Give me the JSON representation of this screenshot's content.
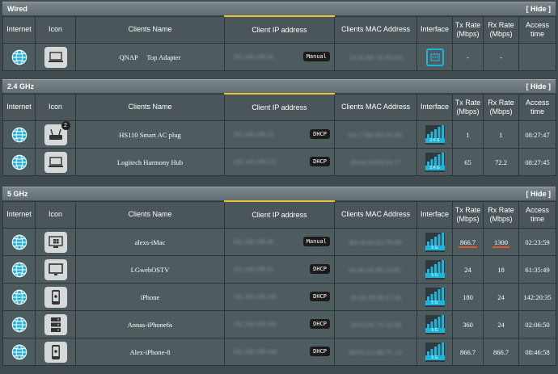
{
  "headers": {
    "internet": "Internet",
    "icon": "Icon",
    "name": "Clients Name",
    "ip": "Client IP address",
    "mac": "Clients MAC Address",
    "iface": "Interface",
    "tx1": "Tx Rate",
    "tx2": "(Mbps)",
    "rx1": "Rx Rate",
    "rx2": "(Mbps)",
    "access": "Access time"
  },
  "hide_label": "[ Hide ]",
  "colors": {
    "accent": "#1fb4d9",
    "highlight": "#e05a1c",
    "ip_header_bar": "#e8c233"
  },
  "sections": [
    {
      "title": "Wired",
      "rows": [
        {
          "icon": "laptop-icon",
          "name": "QNAP     Top Adapter",
          "ip": "192.168.199.56",
          "ip_type": "Manual",
          "mac": "24:5E:BE:1E:9A:E9",
          "iface": "ethernet-icon",
          "tx": "-",
          "rx": "-",
          "access": ""
        }
      ]
    },
    {
      "title": "2.4 GHz",
      "rows": [
        {
          "icon": "router-icon",
          "badge": "2",
          "name": "HS110 Smart AC plug",
          "ip": "192.168.199.23",
          "ip_type": "DHCP",
          "mac": "50:C7:BF:BD:91:BC",
          "iface": "wifi-signal-icon",
          "band": "2.4 G",
          "tx": "1",
          "rx": "1",
          "access": "08:27:47"
        },
        {
          "icon": "laptop-icon",
          "name": "Logitech Harmony Hub",
          "ip": "192.168.199.122",
          "ip_type": "DHCP",
          "mac": "00:04:20:EB:E6:77",
          "iface": "wifi-signal-icon",
          "band": "2.4 G",
          "tx": "65",
          "rx": "72.2",
          "access": "08:27:45"
        }
      ]
    },
    {
      "title": "5 GHz",
      "rows": [
        {
          "icon": "windows-pc-icon",
          "name": "alexs-iMac",
          "ip": "192.168.199.38",
          "ip_type": "Manual",
          "mac": "B4:18:D1:E5:78:0D",
          "iface": "wifi-signal-icon",
          "band": "5 G",
          "tx": "866.7",
          "rx": "1300",
          "access": "02:23:59",
          "highlight": true
        },
        {
          "icon": "monitor-icon",
          "name": "LGwebOSTV",
          "ip": "192.168.199.45",
          "ip_type": "DHCP",
          "mac": "04:4E:AF:0E:53:BC",
          "iface": "wifi-signal-icon",
          "band": "5 G",
          "tx": "24",
          "rx": "18",
          "access": "61:35:49"
        },
        {
          "icon": "iphone-icon",
          "name": "iPhone",
          "ip": "192.168.199.109",
          "ip_type": "DHCP",
          "mac": "28:A0:2B:8E:E7:42",
          "iface": "wifi-signal-icon",
          "band": "5 G",
          "tx": "180",
          "rx": "24",
          "access": "142:20:35"
        },
        {
          "icon": "server-icon",
          "name": "Annas-iPhone6s",
          "ip": "192.168.199.100",
          "ip_type": "DHCP",
          "mac": "20:D5:0C:72:10:39",
          "iface": "wifi-signal-icon",
          "band": "5 G",
          "tx": "360",
          "rx": "24",
          "access": "02:06:50"
        },
        {
          "icon": "iphone-icon",
          "name": "Alex-iPhone-8",
          "ip": "192.168.199.168",
          "ip_type": "DHCP",
          "mac": "B8:F1:2A:8E:7C:13",
          "iface": "wifi-signal-icon",
          "band": "5 G",
          "tx": "866.7",
          "rx": "866.7",
          "access": "08:46:58"
        }
      ]
    }
  ]
}
